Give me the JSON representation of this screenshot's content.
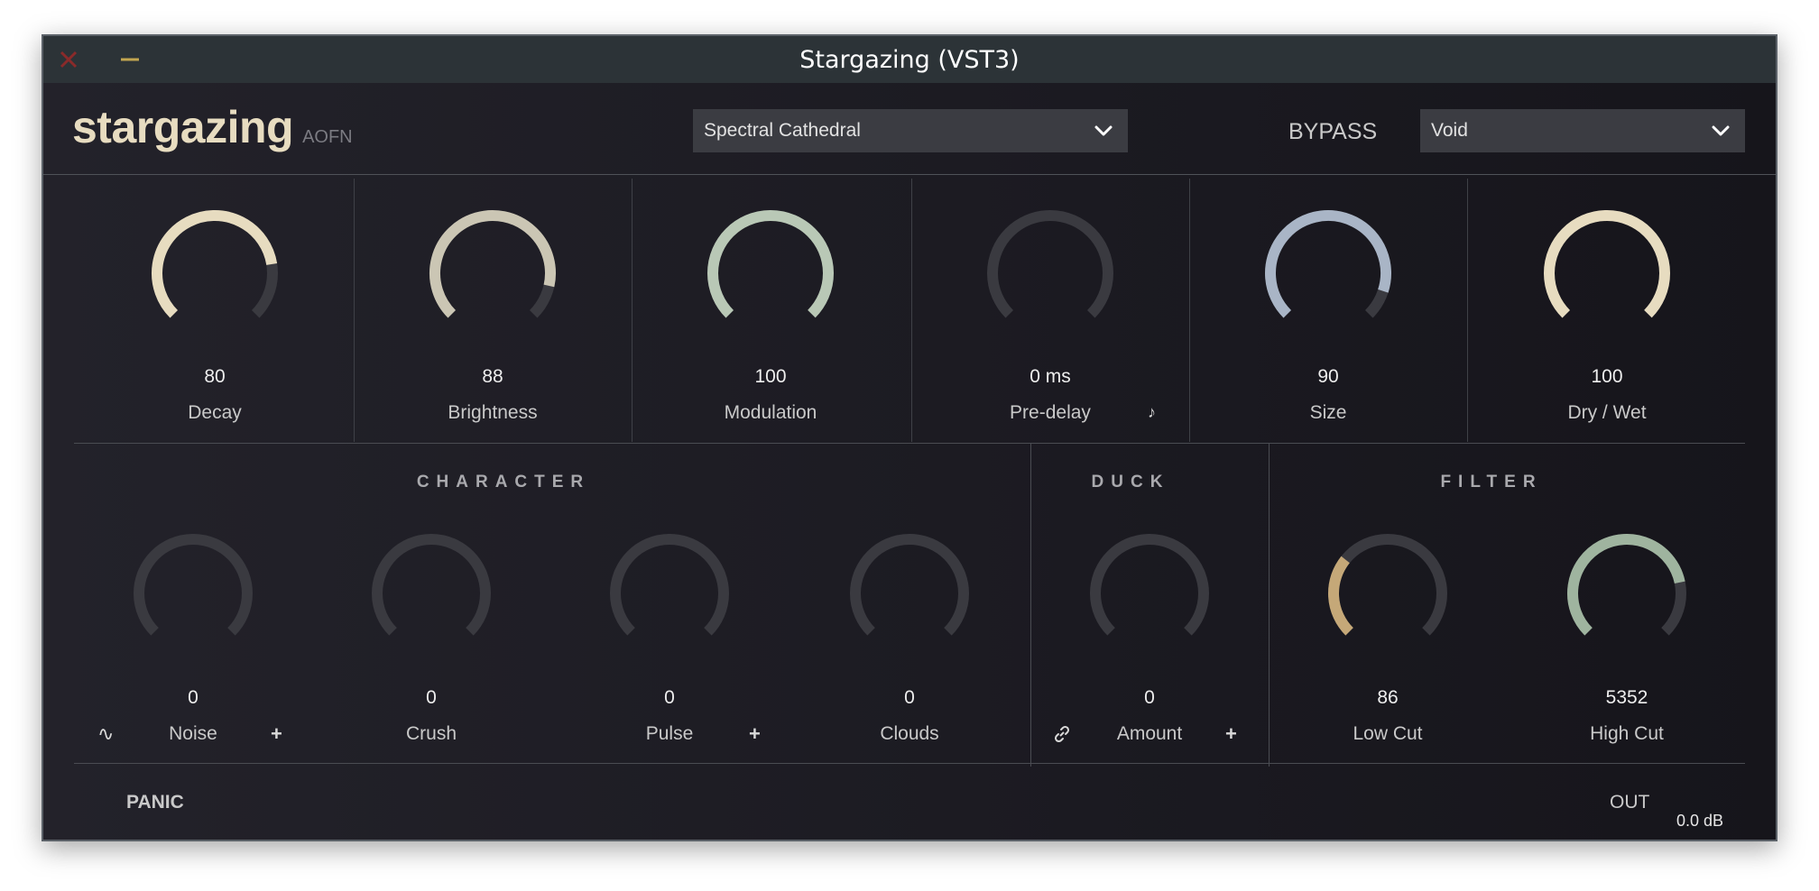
{
  "window": {
    "title": "Stargazing (VST3)"
  },
  "header": {
    "brand": "stargazing",
    "brand_sub": "AOFN",
    "preset": "Spectral Cathedral",
    "bypass_label": "BYPASS",
    "mode": "Void"
  },
  "main_knobs": [
    {
      "value": "80",
      "label": "Decay",
      "fraction": 0.8,
      "color": "#e7dcc0"
    },
    {
      "value": "88",
      "label": "Brightness",
      "fraction": 0.88,
      "color": "#cbc6b4"
    },
    {
      "value": "100",
      "label": "Modulation",
      "fraction": 1.0,
      "color": "#b9c8b6"
    },
    {
      "value": "0 ms",
      "label": "Pre-delay",
      "fraction": 0.0,
      "color": "#d9d9d9"
    },
    {
      "value": "90",
      "label": "Size",
      "fraction": 0.9,
      "color": "#a9b5c6"
    },
    {
      "value": "100",
      "label": "Dry / Wet",
      "fraction": 1.0,
      "color": "#e7dcc0"
    }
  ],
  "sections": {
    "character": "CHARACTER",
    "duck": "DUCK",
    "filter": "FILTER"
  },
  "bottom_knobs": [
    {
      "value": "0",
      "label": "Noise",
      "fraction": 0.0,
      "color": "#d9d9d9"
    },
    {
      "value": "0",
      "label": "Crush",
      "fraction": 0.0,
      "color": "#d9d9d9"
    },
    {
      "value": "0",
      "label": "Pulse",
      "fraction": 0.0,
      "color": "#d9d9d9"
    },
    {
      "value": "0",
      "label": "Clouds",
      "fraction": 0.0,
      "color": "#d9d9d9"
    },
    {
      "value": "0",
      "label": "Amount",
      "fraction": 0.0,
      "color": "#d9d9d9"
    },
    {
      "value": "86",
      "label": "Low Cut",
      "fraction": 0.31,
      "color": "#c5a878"
    },
    {
      "value": "5352",
      "label": "High Cut",
      "fraction": 0.79,
      "color": "#9fb49f"
    }
  ],
  "footer": {
    "panic": "PANIC",
    "out_label": "OUT",
    "out_value": "0.0 dB"
  },
  "colors": {
    "track": "#3a3a40",
    "accent": "#e7dcc0"
  }
}
